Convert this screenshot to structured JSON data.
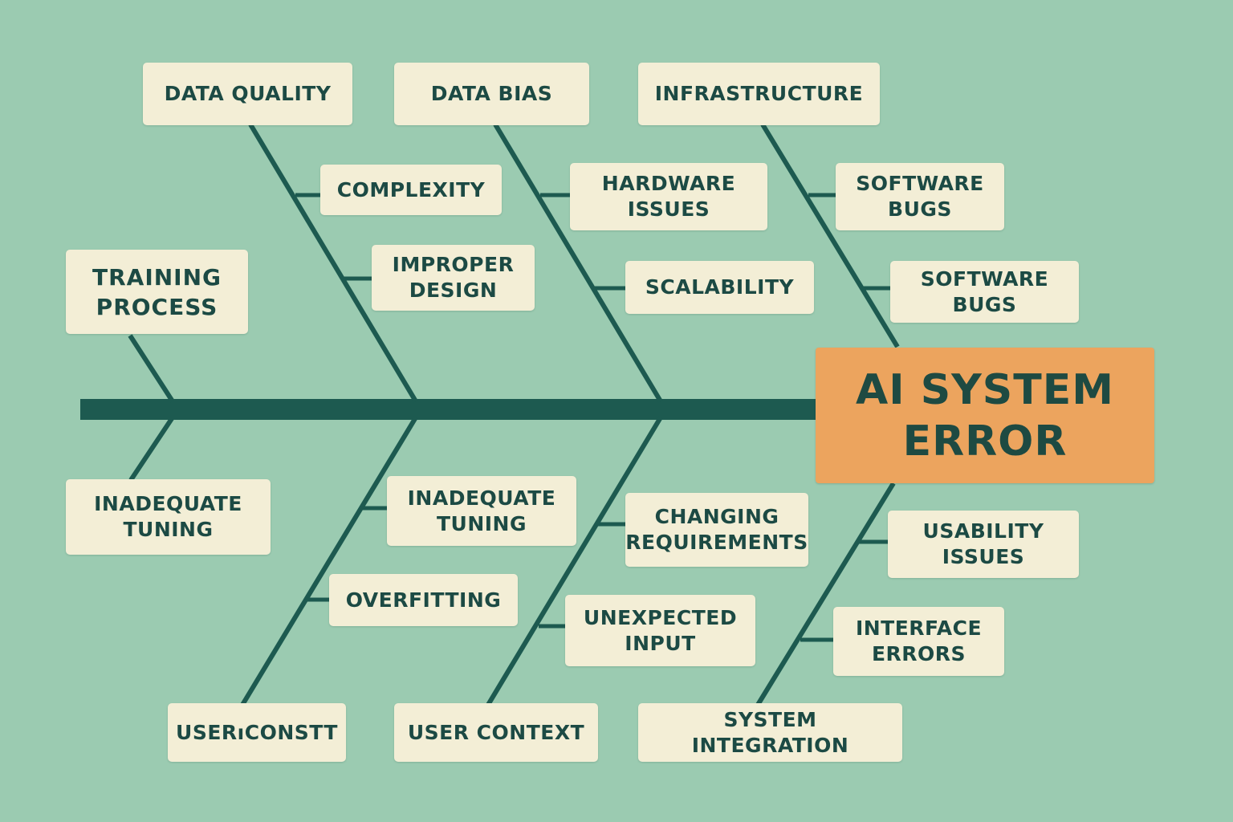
{
  "effect": "AI SYSTEM\nERROR",
  "colors": {
    "background": "#9bcbb1",
    "spine": "#1d5a50",
    "box_fill": "#f3eed6",
    "box_text": "#1c4a44",
    "head_fill": "#eca45e"
  },
  "causes": {
    "data_quality": {
      "label": "DATA QUALITY",
      "subs": [
        "COMPLEXITY",
        "IMPROPER\nDESIGN"
      ]
    },
    "data_bias": {
      "label": "DATA BIAS",
      "subs": [
        "HARDWARE\nISSUES",
        "SCALABILITY"
      ]
    },
    "infrastructure": {
      "label": "INFRASTRUCTURE",
      "subs": [
        "SOFTWARE\nBUGS",
        "SOFTWARE\nBUGS"
      ]
    },
    "training_process": {
      "label": "TRAINING\nPROCESS",
      "subs": []
    },
    "inadequate_tuning_left": {
      "label": "INADEQUATE\nTUNING",
      "subs": []
    },
    "user_const": {
      "label": "USERıCONSTT",
      "subs": [
        "INADEQUATE\nTUNING",
        "OVERFITTING"
      ]
    },
    "user_context": {
      "label": "USER CONTEXT",
      "subs": [
        "CHANGING\nREQUIREMENTS",
        "UNEXPECTED\nINPUT"
      ]
    },
    "system_integration": {
      "label": "SYSTEM INTEGRATION",
      "subs": [
        "USABILITY\nISSUES",
        "INTERFACE\nERRORS"
      ]
    }
  }
}
